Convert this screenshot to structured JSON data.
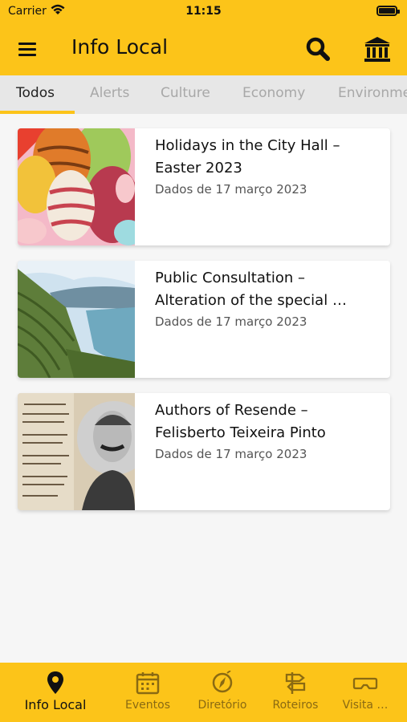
{
  "status": {
    "carrier": "Carrier",
    "time": "11:15"
  },
  "header": {
    "title": "Info Local",
    "icons": [
      "menu-icon",
      "search-icon",
      "city-hall-icon"
    ]
  },
  "tabs": [
    {
      "label": "Todos",
      "active": true
    },
    {
      "label": "Alerts",
      "active": false
    },
    {
      "label": "Culture",
      "active": false
    },
    {
      "label": "Economy",
      "active": false
    },
    {
      "label": "Environme",
      "active": false
    }
  ],
  "articles": [
    {
      "title": "Holidays in the City Hall – Easter 2023",
      "date": "Dados de 17 março 2023"
    },
    {
      "title": "Public Consultation – Alteration of the special …",
      "date": "Dados de 17 março 2023"
    },
    {
      "title": "Authors of Resende – Felisberto Teixeira Pinto",
      "date": "Dados de 17 março 2023"
    }
  ],
  "bottom_nav": [
    {
      "label": "Info Local",
      "icon": "map-pin-icon",
      "active": true
    },
    {
      "label": "Eventos",
      "icon": "calendar-icon",
      "active": false
    },
    {
      "label": "Diretório",
      "icon": "compass-icon",
      "active": false
    },
    {
      "label": "Roteiros",
      "icon": "signpost-icon",
      "active": false
    },
    {
      "label": "Visita …",
      "icon": "vr-headset-icon",
      "active": false
    }
  ],
  "colors": {
    "accent": "#fcc419",
    "inactive_nav": "#8a6a12",
    "tab_bar": "#e7e7e7"
  }
}
